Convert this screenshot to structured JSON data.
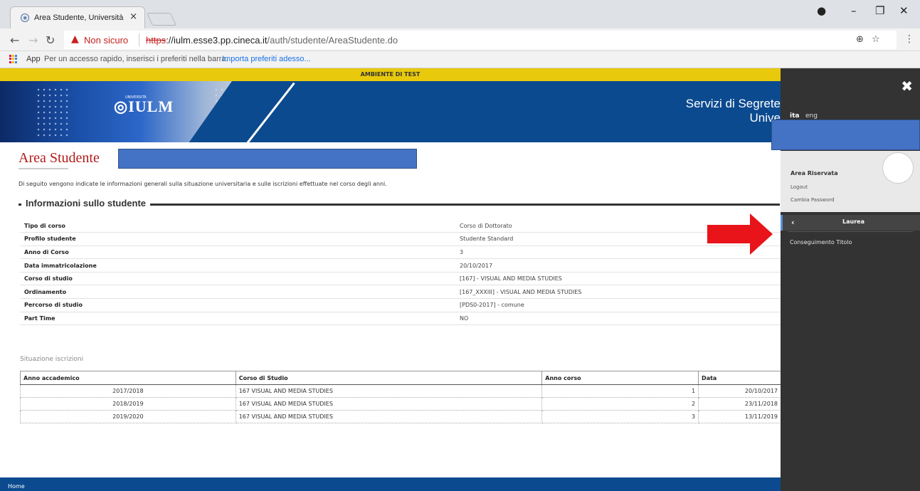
{
  "browser": {
    "tab_title": "Area Studente, Università",
    "tab_close": "×",
    "favicon": "IULM-favicon",
    "not_secure": "Non sicuro",
    "url_proto": "https",
    "url_host": "://iulm.esse3.pp.cineca.it",
    "url_path": "/auth/studente/AreaStudente.do",
    "bookmarks_apps": "App",
    "bookmarks_hint": "Per un accesso rapido, inserisci i preferiti nella barra.",
    "bookmarks_import": "Importa preferiti adesso..."
  },
  "banner": {
    "test_env": "AMBIENTE DI TEST",
    "logo": "IULM",
    "logo_small": "UNIVERSITÀ",
    "title_line1": "Servizi di Segrete",
    "title_line2": "Unive"
  },
  "page": {
    "title": "Area Studente",
    "intro": "Di seguito vengono indicate le informazioni generali sulla situazione universitaria e sulle iscrizioni effettuate nel corso degli anni.",
    "section_info": "Informazioni sullo studente",
    "info_rows": [
      {
        "label": "Tipo di corso",
        "value": "Corso di Dottorato"
      },
      {
        "label": "Profilo studente",
        "value": "Studente Standard"
      },
      {
        "label": "Anno di Corso",
        "value": "3"
      },
      {
        "label": "Data immatricolazione",
        "value": "20/10/2017"
      },
      {
        "label": "Corso di studio",
        "value": "[167] - VISUAL AND MEDIA STUDIES"
      },
      {
        "label": "Ordinamento",
        "value": "[167_XXXIII] - VISUAL AND MEDIA STUDIES"
      },
      {
        "label": "Percorso di studio",
        "value": "[PDS0-2017] - comune"
      },
      {
        "label": "Part Time",
        "value": "NO"
      }
    ],
    "section_enroll": "Situazione iscrizioni",
    "enroll_headers": [
      "Anno accademico",
      "Corso di Studio",
      "Anno corso",
      "Data"
    ],
    "enroll_rows": [
      [
        "2017/2018",
        "167 VISUAL AND MEDIA STUDIES",
        "1",
        "20/10/2017"
      ],
      [
        "2018/2019",
        "167 VISUAL AND MEDIA STUDIES",
        "2",
        "23/11/2018"
      ],
      [
        "2019/2020",
        "167 VISUAL AND MEDIA STUDIES",
        "3",
        "13/11/2019"
      ]
    ],
    "footer_home": "Home"
  },
  "sidepanel": {
    "close": "✖",
    "lang_ita": "ita",
    "lang_eng": "eng",
    "area_riservata": "Area Riservata",
    "logout": "Logout",
    "change_password": "Cambia Password",
    "back": "‹",
    "menu_title": "Laurea",
    "menu_item": "Conseguimento Titolo"
  },
  "colors": {
    "accent_blue": "#0b4a8f",
    "test_yellow": "#e8c90c",
    "title_red": "#b31b1b",
    "arrow_red": "#e8141a"
  }
}
